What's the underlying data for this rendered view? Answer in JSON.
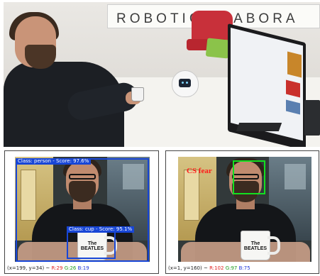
{
  "photo": {
    "sign_text": "ROBOTICS LABORA"
  },
  "left_view": {
    "detections": [
      {
        "label": "Class: person - Score: 97.6%"
      },
      {
        "label": "Class: cup - Score: 95.1%"
      }
    ],
    "mug_text": "The BEATLES",
    "status": {
      "coords": "(x=199, y=34) ~",
      "r": "R:29",
      "g": "G:26",
      "b": "B:19"
    }
  },
  "right_view": {
    "emotion": "CS fear",
    "mug_text": "The BEATLES",
    "status": {
      "coords": "(x=1, y=160) ~",
      "r": "R:102",
      "g": "G:97",
      "b": "B:75"
    }
  },
  "colors": {
    "detection_box": "#1846d6",
    "face_box": "#13e020",
    "emotion_text": "#ff1a1a"
  }
}
